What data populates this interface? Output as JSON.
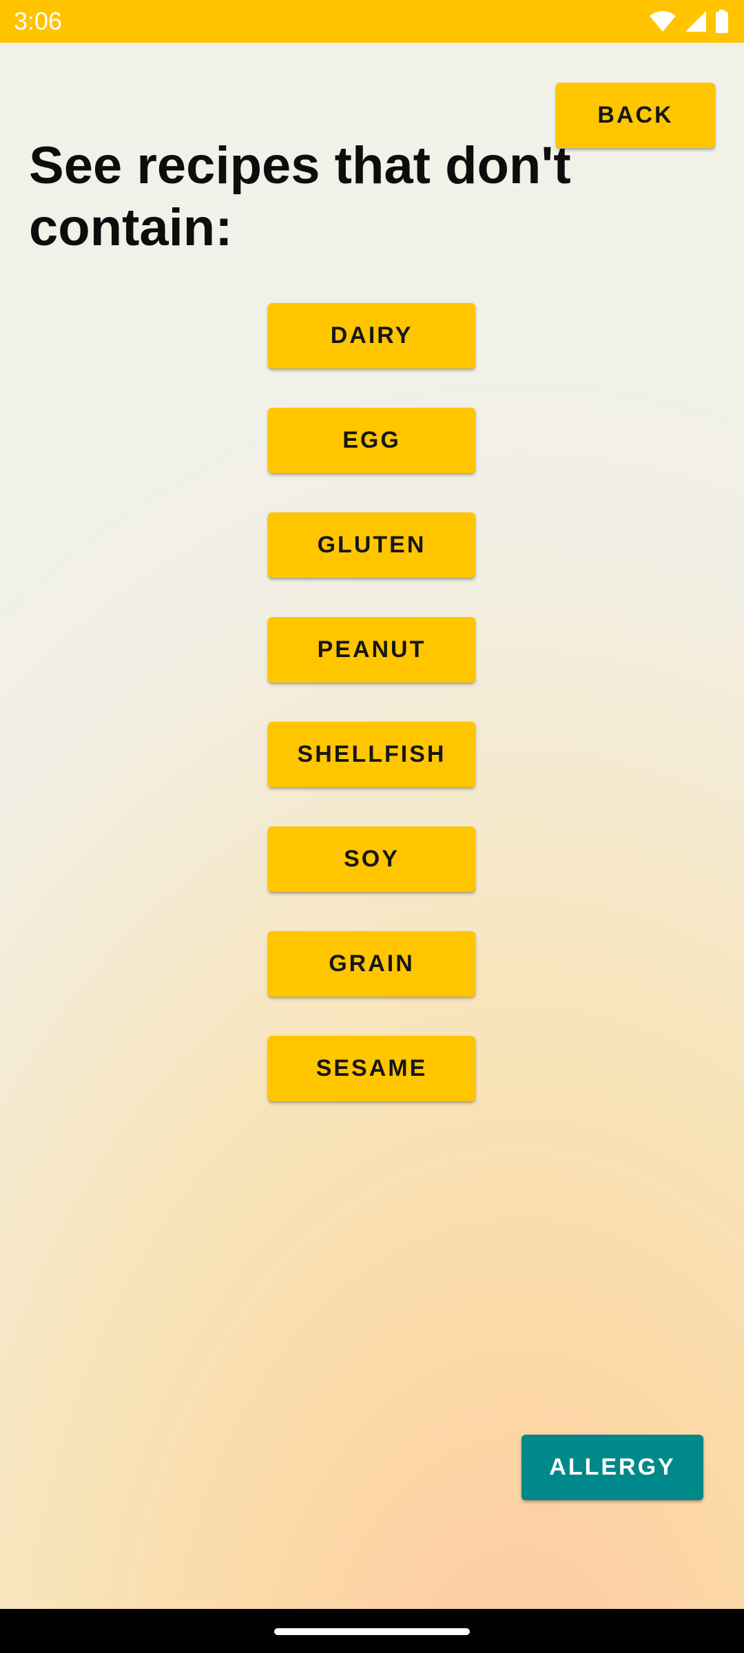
{
  "status_bar": {
    "time": "3:06",
    "icons": [
      "wifi-icon",
      "cellular-signal-icon",
      "battery-icon"
    ],
    "color": "#ffc300"
  },
  "header": {
    "back_label": "BACK"
  },
  "title": "See recipes that don't contain:",
  "allergens": [
    {
      "label": "DAIRY"
    },
    {
      "label": "EGG"
    },
    {
      "label": "GLUTEN"
    },
    {
      "label": "PEANUT"
    },
    {
      "label": "SHELLFISH"
    },
    {
      "label": "SOY"
    },
    {
      "label": "GRAIN"
    },
    {
      "label": "SESAME"
    }
  ],
  "footer": {
    "allergy_label": "ALLERGY"
  },
  "colors": {
    "accent_yellow": "#ffc600",
    "teal": "#00898a"
  }
}
